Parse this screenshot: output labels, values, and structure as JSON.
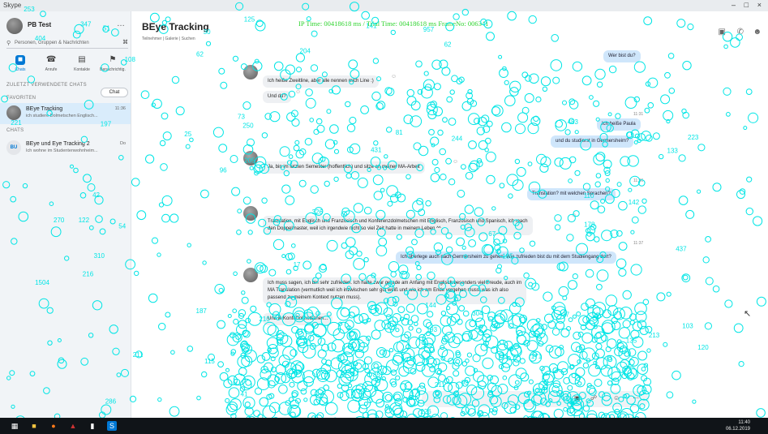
{
  "window": {
    "app_name": "Skype",
    "controls": [
      "–",
      "□",
      "×"
    ]
  },
  "profile": {
    "name": "PB Test",
    "more": "…"
  },
  "search": {
    "placeholder": "Personen, Gruppen & Nachrichten",
    "shortcut": "⌘"
  },
  "nav": [
    {
      "label": "Chats",
      "icon": "chat-icon",
      "glyph": "■",
      "active": true
    },
    {
      "label": "Anrufe",
      "icon": "phone-icon",
      "glyph": "☎",
      "active": false
    },
    {
      "label": "Kontakte",
      "icon": "contacts-icon",
      "glyph": "▤",
      "active": false
    },
    {
      "label": "Benachrichtig.",
      "icon": "bell-icon",
      "glyph": "⚑",
      "active": false
    }
  ],
  "sections": {
    "recent": "ZULETZT VERWENDETE CHATS",
    "favorites": "FAVORITEN",
    "chats": "CHATS"
  },
  "chat_button": "Chat",
  "conversations": [
    {
      "name": "BEye Tracking",
      "preview": "ich studiere Dolmetschen Englisch...",
      "time": "11:36",
      "selected": true,
      "avatar_text": ""
    },
    {
      "name": "BEye und Eye Tracking 2",
      "preview": "Ich wohne im Studentenwohnheim...",
      "time": "Do",
      "selected": false,
      "avatar_text": "BU"
    }
  ],
  "header": {
    "title": "BEye Tracking",
    "subtitle": "Teilnehmer | Galerie | Suchen",
    "icons": [
      "video-call-icon",
      "phone-call-icon",
      "add-person-icon"
    ]
  },
  "overlay": {
    "text": "IP Time: 00418618 ms  /  Trial Time: 00418618 ms    FrameNo: 006341"
  },
  "messages": [
    {
      "dir": "out",
      "text": "Wer bist du?"
    },
    {
      "dir": "in",
      "text": "Ich heiße Zweitline, aber alle nennen mich Line :)"
    },
    {
      "dir": "in",
      "text": "Und du?"
    },
    {
      "dir": "out",
      "text": "Ich heiße Paula"
    },
    {
      "dir": "out",
      "text": "und du studierst in Germersheim?"
    },
    {
      "dir": "in",
      "text": "Ja, bin im letzten Semester (hoffentlich) und sitze an meiner MA-Arbeit"
    },
    {
      "dir": "out",
      "text": "Translation? mit welchen Sprachen?"
    },
    {
      "dir": "in",
      "text": "Translation, mit Englisch und Französisch und Konferenzdolmetschen mit Englisch, Französisch und Spanisch, ich mach\nden Doppelmaster, weil ich irgendwie nicht so viel Zeit hatte in meinem Leben ^^"
    },
    {
      "dir": "out",
      "text": "Ich überlege auch nach Germersheim zu gehen. Wie zufrieden bist du mit dem Studiengang dort?"
    },
    {
      "dir": "in",
      "text": "Ich muss sagen, ich bin sehr zufrieden. Ich hatte zwar gerade am Anfang mit Englisch besonders viel Freude, auch im\nMA Translation (vermutlich weil ich inzwischen sehr gut weiß und wie ich am Ende vorgehen muss, was ich also\npassend zu meinem Kontext nutzen muss)."
    },
    {
      "dir": "in",
      "text": "Und in Konfi Dolmetschen..."
    }
  ],
  "timestamps": [
    "11:31",
    "11:36",
    "11:37"
  ],
  "composer_icons": [
    "image-icon",
    "attach-icon",
    "emoji-icon",
    "more-icon"
  ],
  "taskbar": {
    "icons": [
      "windows-icon",
      "explorer-icon",
      "firefox-icon",
      "app-icon",
      "file-icon",
      "skype-icon"
    ],
    "time": "11:40",
    "date": "06.12.2019"
  },
  "gaze_labels": [
    "205",
    "81",
    "226",
    "270",
    "431",
    "437",
    "483",
    "210",
    "347",
    "957",
    "1504",
    "171",
    "103",
    "211",
    "286",
    "857",
    "120",
    "93",
    "133",
    "115",
    "193",
    "211",
    "142",
    "253",
    "178",
    "96",
    "173",
    "197",
    "62",
    "41",
    "187",
    "326",
    "30",
    "25",
    "304",
    "223",
    "204",
    "135",
    "37",
    "42",
    "51",
    "108",
    "216",
    "221",
    "144",
    "404",
    "122",
    "73",
    "67",
    "250",
    "125",
    "310",
    "141",
    "110",
    "17",
    "244",
    "62",
    "185",
    "54",
    "213"
  ]
}
